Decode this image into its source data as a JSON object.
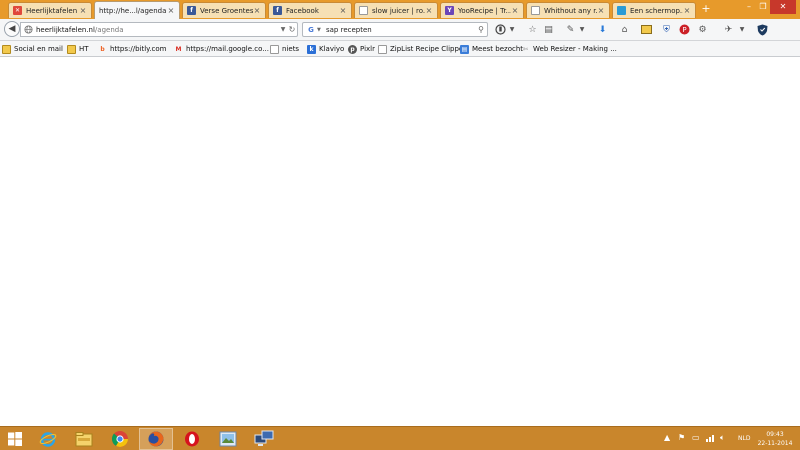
{
  "browser": {
    "tabs": [
      {
        "title": "Heerlijktafelen ...",
        "icon": "heerlijktafelen-favicon",
        "active": false
      },
      {
        "title": "http://he...l/agenda",
        "icon": "",
        "active": true
      },
      {
        "title": "Verse Groentes...",
        "icon": "facebook-icon",
        "active": false
      },
      {
        "title": "Facebook",
        "icon": "facebook-icon",
        "active": false
      },
      {
        "title": "slow juicer | ro...",
        "icon": "page-icon",
        "active": false
      },
      {
        "title": "YooRecipe | Tr...",
        "icon": "yoorecipe-icon",
        "active": false
      },
      {
        "title": "Whithout any r...",
        "icon": "page-icon",
        "active": false
      },
      {
        "title": "Een schermop...",
        "icon": "page-icon",
        "active": false
      }
    ],
    "new_tab": "+",
    "window_controls": {
      "minimize": "–",
      "maximize": "❐",
      "close": "✕"
    },
    "nav": {
      "url_host": "heerlijktafelen.nl",
      "url_path": "/agenda",
      "search_value": "sap recepten",
      "search_engine": "G"
    },
    "bookmarks": [
      {
        "label": "Social en mail",
        "icon": "folder-icon"
      },
      {
        "label": "HT",
        "icon": "folder-icon"
      },
      {
        "label": "https://bitly.com",
        "icon": "bitly-icon"
      },
      {
        "label": "https://mail.google.co...",
        "icon": "gmail-icon"
      },
      {
        "label": "niets",
        "icon": "page-icon"
      },
      {
        "label": "Klaviyo",
        "icon": "klaviyo-icon"
      },
      {
        "label": "Pixlr",
        "icon": "pixlr-icon"
      },
      {
        "label": "ZipList Recipe Clipper",
        "icon": "page-icon"
      },
      {
        "label": "Meest bezocht",
        "icon": "most-visited-icon"
      },
      {
        "label": "Web Resizer - Making ...",
        "icon": "web-resizer-icon"
      }
    ]
  },
  "taskbar": {
    "language": "NLD",
    "time": "09:43",
    "date": "22-11-2014"
  },
  "colors": {
    "tabstrip": "#e79a2b",
    "taskbar": "#c9862c",
    "facebook": "#3b5998"
  }
}
